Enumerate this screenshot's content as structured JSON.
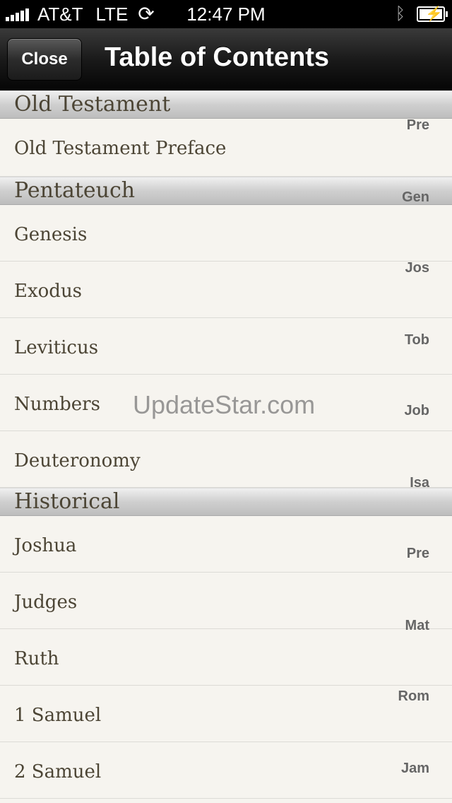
{
  "status_bar": {
    "carrier": "AT&T",
    "network": "LTE",
    "time": "12:47 PM"
  },
  "nav_bar": {
    "close_label": "Close",
    "title": "Table of Contents"
  },
  "sections": [
    {
      "header": "Old Testament",
      "items": [
        "Old Testament Preface"
      ]
    },
    {
      "header": "Pentateuch",
      "items": [
        "Genesis",
        "Exodus",
        "Leviticus",
        "Numbers",
        "Deuteronomy"
      ]
    },
    {
      "header": "Historical",
      "items": [
        "Joshua",
        "Judges",
        "Ruth",
        "1 Samuel",
        "2 Samuel"
      ]
    }
  ],
  "index": [
    "Pre",
    "Gen",
    "Jos",
    "Tob",
    "Job",
    "Isa",
    "Pre",
    "Mat",
    "Rom",
    "Jam"
  ],
  "watermark": "UpdateStar.com"
}
